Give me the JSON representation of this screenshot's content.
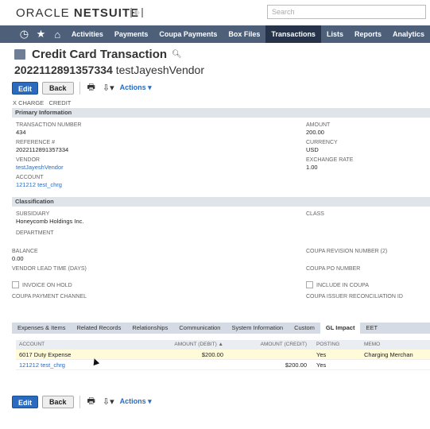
{
  "header": {
    "logo_oracle": "ORACLE",
    "logo_netsuite": "NETSUITE",
    "search_placeholder": "Search"
  },
  "nav": {
    "icons": [
      "recent-icon",
      "star-icon",
      "home-icon"
    ],
    "items": [
      {
        "label": "Activities"
      },
      {
        "label": "Payments"
      },
      {
        "label": "Coupa Payments"
      },
      {
        "label": "Box Files"
      },
      {
        "label": "Transactions"
      },
      {
        "label": "Lists"
      },
      {
        "label": "Reports"
      },
      {
        "label": "Analytics"
      }
    ],
    "active": "Transactions"
  },
  "page": {
    "title": "Credit Card Transaction",
    "subtitle_number": "2022112891357334",
    "subtitle_name": "testJayeshVendor",
    "xcharge": "X CHARGE",
    "credit": "CREDIT"
  },
  "toolbar": {
    "edit": "Edit",
    "back": "Back",
    "actions": "Actions ▾"
  },
  "primary": {
    "header": "Primary Information",
    "transaction_number_label": "TRANSACTION NUMBER",
    "transaction_number": "434",
    "reference_label": "REFERENCE #",
    "reference": "2022112891357334",
    "vendor_label": "VENDOR",
    "vendor": "testJayeshVendor",
    "account_label": "ACCOUNT",
    "account": "121212 test_chrg",
    "amount_label": "AMOUNT",
    "amount": "200.00",
    "currency_label": "CURRENCY",
    "currency": "USD",
    "exchange_rate_label": "EXCHANGE RATE",
    "exchange_rate": "1.00"
  },
  "classification": {
    "header": "Classification",
    "subsidiary_label": "SUBSIDIARY",
    "subsidiary": "Honeycomb Holdings Inc.",
    "department_label": "DEPARTMENT",
    "class_label": "CLASS"
  },
  "other": {
    "balance_label": "BALANCE",
    "balance": "0.00",
    "vendor_lead_time_label": "VENDOR LEAD TIME (DAYS)",
    "invoice_on_hold_label": "INVOICE ON HOLD",
    "coupa_payment_channel_label": "COUPA PAYMENT CHANNEL",
    "coupa_revision_label": "COUPA REVISION NUMBER (2)",
    "coupa_po_label": "COUPA PO NUMBER",
    "include_in_coupa_label": "INCLUDE IN COUPA",
    "coupa_issuer_label": "COUPA ISSUER RECONCILIATION ID"
  },
  "tabs": [
    {
      "label": "Expenses & Items"
    },
    {
      "label": "Related Records"
    },
    {
      "label": "Relationships"
    },
    {
      "label": "Communication"
    },
    {
      "label": "System Information"
    },
    {
      "label": "Custom"
    },
    {
      "label": "GL Impact"
    },
    {
      "label": "EET"
    }
  ],
  "active_tab": "GL Impact",
  "gl": {
    "columns": [
      "ACCOUNT",
      "AMOUNT (DEBIT) ▲",
      "AMOUNT (CREDIT)",
      "POSTING",
      "MEMO"
    ],
    "rows": [
      {
        "account": "6017 Duty Expense",
        "debit": "$200.00",
        "credit": "",
        "posting": "Yes",
        "memo": "Charging Merchan"
      },
      {
        "account": "121212 test_chrg",
        "debit": "",
        "credit": "$200.00",
        "posting": "Yes",
        "memo": ""
      }
    ]
  },
  "colors": {
    "navbar": "#4d5f79",
    "nav_active": "#263348",
    "primary_button": "#2a6bbf",
    "section_header": "#dfe4eb"
  }
}
